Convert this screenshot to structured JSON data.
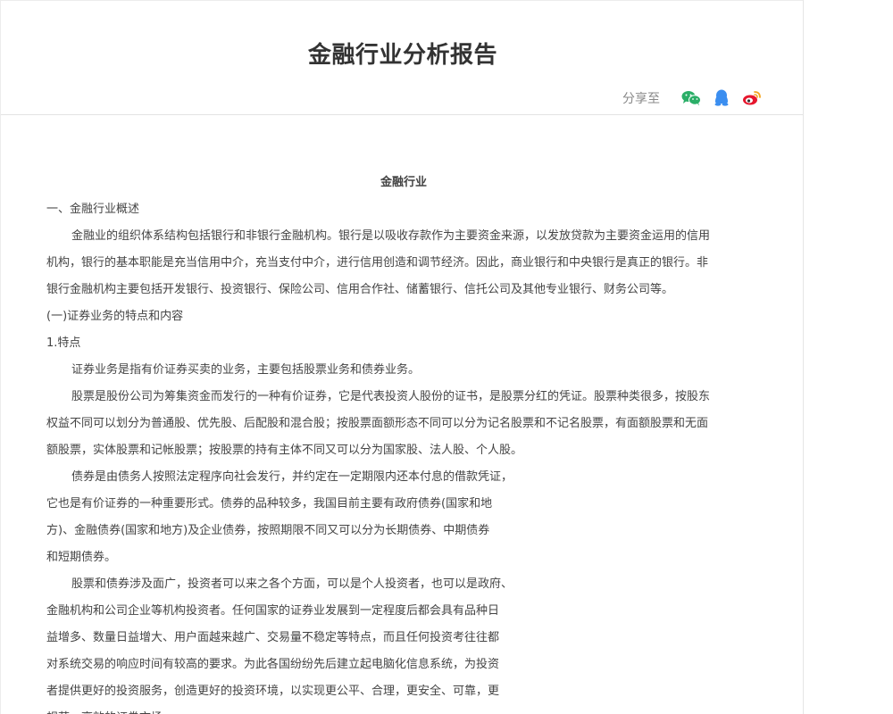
{
  "page": {
    "title": "金融行业分析报告"
  },
  "share": {
    "label": "分享至",
    "icons": [
      "wechat-icon",
      "qq-icon",
      "weibo-icon"
    ],
    "colors": {
      "wechat": "#2aae67",
      "qq": "#3b8ef0",
      "weibo": "#e6162d"
    }
  },
  "document": {
    "heading": "金融行业",
    "lines": [
      {
        "text": "一、金融行业概述",
        "indent": false
      },
      {
        "text": "金融业的组织体系结构包括银行和非银行金融机构。银行是以吸收存款作为主要资金来源，以发放贷款为主要资金运用的信用",
        "indent": true
      },
      {
        "text": "机构，银行的基本职能是充当信用中介，充当支付中介，进行信用创造和调节经济。因此，商业银行和中央银行是真正的银行。非",
        "indent": false
      },
      {
        "text": "银行金融机构主要包括开发银行、投资银行、保险公司、信用合作社、储蓄银行、信托公司及其他专业银行、财务公司等。",
        "indent": false
      },
      {
        "text": "(一)证券业务的特点和内容",
        "indent": false
      },
      {
        "text": "1.特点",
        "indent": false
      },
      {
        "text": "证券业务是指有价证券买卖的业务，主要包括股票业务和债券业务。",
        "indent": true
      },
      {
        "text": "股票是股份公司为筹集资金而发行的一种有价证券，它是代表投资人股份的证书，是股票分红的凭证。股票种类很多，按股东",
        "indent": true
      },
      {
        "text": "权益不同可以划分为普通股、优先股、后配股和混合股；按股票面额形态不同可以分为记名股票和不记名股票，有面额股票和无面",
        "indent": false
      },
      {
        "text": "额股票，实体股票和记帐股票；按股票的持有主体不同又可以分为国家股、法人股、个人股。",
        "indent": false
      },
      {
        "text": "债券是由债务人按照法定程序向社会发行，并约定在一定期限内还本付息的借款凭证，",
        "indent": true
      },
      {
        "text": "它也是有价证券的一种重要形式。债券的品种较多，我国目前主要有政府债券(国家和地",
        "indent": false
      },
      {
        "text": "方)、金融债券(国家和地方)及企业债券，按照期限不同又可以分为长期债券、中期债券",
        "indent": false
      },
      {
        "text": "和短期债券。",
        "indent": false
      },
      {
        "text": "股票和债券涉及面广，投资者可以来之各个方面，可以是个人投资者，也可以是政府、",
        "indent": true
      },
      {
        "text": "金融机构和公司企业等机构投资者。任何国家的证券业发展到一定程度后都会具有品种日",
        "indent": false
      },
      {
        "text": "益增多、数量日益增大、用户面越来越广、交易量不稳定等特点，而且任何投资考往往都",
        "indent": false
      },
      {
        "text": "对系统交易的响应时间有较高的要求。为此各国纷纷先后建立起电脑化信息系统，为投资",
        "indent": false
      },
      {
        "text": "者提供更好的投资服务，创造更好的投资环境，以实现更公平、合理，更安全、可靠，更",
        "indent": false
      },
      {
        "text": "规范、高效的证券市场。",
        "indent": false
      }
    ]
  }
}
